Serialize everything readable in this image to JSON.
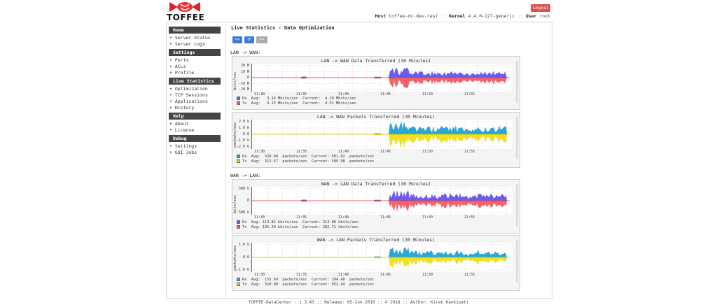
{
  "brand": {
    "name": "TOFFEE"
  },
  "header": {
    "logout_label": "Logout",
    "host_label": "Host",
    "host_value": "toffee-dc-dev-test",
    "kernel_label": "Kernel",
    "kernel_value": "4.4.0-127-generic",
    "user_label": "User",
    "user_value": "root",
    "separator": "::"
  },
  "sidebar": {
    "sections": [
      {
        "title": "Home",
        "items": [
          "+ Server Status",
          "+ Server Logs"
        ]
      },
      {
        "title": "Settings",
        "items": [
          "+ Ports",
          "+ ACLs",
          "+ Profile"
        ]
      },
      {
        "title": "Live Statistics",
        "items": [
          "+ Optimization",
          "+ TCP Sessions",
          "+ Applications",
          "+ History"
        ]
      },
      {
        "title": "Help",
        "items": [
          "+ About",
          "+ License"
        ]
      },
      {
        "title": "Debug",
        "items": [
          "+ Settings",
          "+ GUI Jobs"
        ]
      }
    ]
  },
  "main": {
    "title": "Live Statistics - Data Optimization",
    "nav": {
      "prev": "<<",
      "refresh": "⟳",
      "next": ">>"
    },
    "section1": "LAN -> WAN:",
    "section2": "WAN -> LAN:"
  },
  "colors": {
    "rx_data": "#6b5cf0",
    "tx_data": "#f2636b",
    "rx_pkt": "#29a8d8",
    "tx_pkt": "#f0e020",
    "logout": "#d9534f",
    "nav": "#3a7bd5"
  },
  "graphs": [
    {
      "title": "LAN -> WAN Data Transferred (30 Minutes)",
      "ylabel": "bits/sec",
      "yticks": [
        "20 M",
        "10 M",
        "0",
        "-10 M",
        "-20 M"
      ],
      "xticks": [
        "11:30",
        "11:35",
        "11:40",
        "11:45",
        "11:50",
        "11:55"
      ],
      "legend": [
        {
          "key": "Rx",
          "avg": "Avg:   3.14 Mbits/sec",
          "cur": "Current:  4.10 Mbits/sec"
        },
        {
          "key": "Tx",
          "avg": "Avg:   3.13 Mbits/sec",
          "cur": "Current:  4.51 Mbits/sec"
        }
      ]
    },
    {
      "title": "LAN -> WAN Packets Transferred (30 Minutes)",
      "ylabel": "packets/sec",
      "yticks": [
        "2.0 k",
        "1.0 k",
        "0.0",
        "-1.0 k",
        "-2.0 k"
      ],
      "xticks": [
        "11:30",
        "11:35",
        "11:40",
        "11:45",
        "11:50",
        "11:55"
      ],
      "legend": [
        {
          "key": "Rx",
          "avg": "Avg:  320.08  packets/sec",
          "cur": "Current: 501.02  packets/sec"
        },
        {
          "key": "Tx",
          "avg": "Avg:  312.57  packets/sec",
          "cur": "Current: 509.98  packets/sec"
        }
      ]
    },
    {
      "title": "WAN -> LAN Data Transferred (30 Minutes)",
      "ylabel": "bits/sec",
      "yticks": [
        "500 k",
        "0",
        "-500 k"
      ],
      "xticks": [
        "11:30",
        "11:35",
        "11:40",
        "11:45",
        "11:50",
        "11:55"
      ],
      "legend": [
        {
          "key": "Rx",
          "avg": "Avg: 113.82 kbits/sec",
          "cur": "Current: 213.06 kbits/sec"
        },
        {
          "key": "Tx",
          "avg": "Avg: 135.20 kbits/sec",
          "cur": "Current: 282.71 kbits/sec"
        }
      ]
    },
    {
      "title": "WAN -> LAN Packets Transferred (30 Minutes)",
      "ylabel": "packets/sec",
      "yticks": [
        "1.0 k",
        "0.0",
        "-1.0 k"
      ],
      "xticks": [
        "11:30",
        "11:35",
        "11:40",
        "11:45",
        "11:50",
        "11:55"
      ],
      "legend": [
        {
          "key": "Rx",
          "avg": "Avg:  155.69  packets/sec",
          "cur": "Current: 294.40  packets/sec"
        },
        {
          "key": "Tx",
          "avg": "Avg:  310.00  packets/sec",
          "cur": "Current: 652.44  packets/sec"
        }
      ]
    }
  ],
  "footer": "TOFFEE-DataCenter - 1.3.43 :: Release: 05-Jun-2018 :: © 2018 :: Author: Kiran Kankipati"
}
